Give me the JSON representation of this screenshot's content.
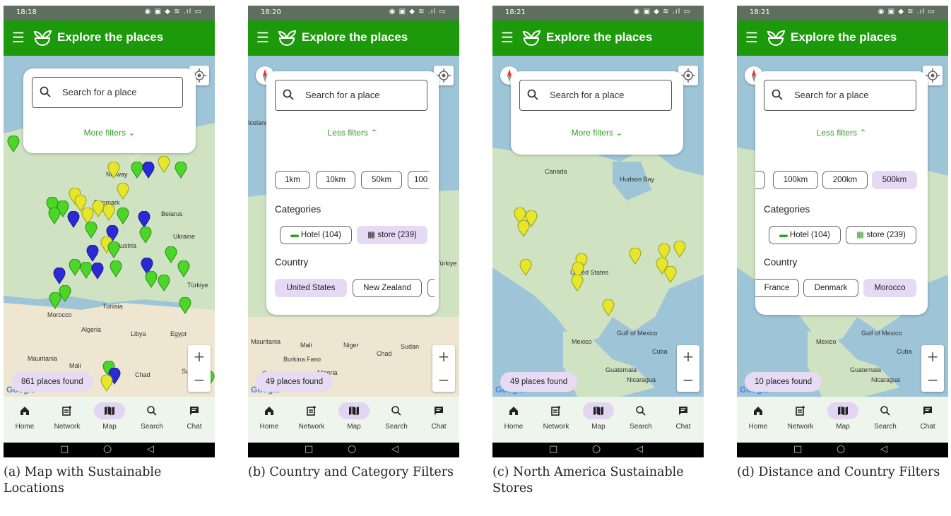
{
  "screens": [
    {
      "time": "18:18",
      "battery": "86",
      "title": "Explore the places",
      "search_placeholder": "Search for a place",
      "filter_toggle": "More filters",
      "count": "861 places found",
      "caption": "(a) Map with Sustainable Locations"
    },
    {
      "time": "18:20",
      "battery": "87",
      "title": "Explore the places",
      "search_placeholder": "Search for a place",
      "filter_toggle": "Less filters",
      "distances": [
        "1km",
        "10km",
        "50km",
        "100"
      ],
      "categories_heading": "Categories",
      "categories": [
        "Hotel (104)",
        "store (239)"
      ],
      "country_heading": "Country",
      "countries": [
        "United States",
        "New Zealand"
      ],
      "count": "49 places found",
      "caption": "(b) Country and Category Filters"
    },
    {
      "time": "18:21",
      "battery": "87",
      "title": "Explore the places",
      "search_placeholder": "Search for a place",
      "filter_toggle": "More filters",
      "count": "49 places found",
      "caption": "(c) North America Sustainable Stores"
    },
    {
      "time": "18:21",
      "battery": "87",
      "title": "Explore the places",
      "search_placeholder": "Search for a place",
      "filter_toggle": "Less filters",
      "distances": [
        "100km",
        "200km",
        "500km"
      ],
      "categories_heading": "Categories",
      "categories": [
        "Hotel (104)",
        "store (239)"
      ],
      "country_heading": "Country",
      "countries": [
        "France",
        "Denmark",
        "Morocco"
      ],
      "count": "10 places found",
      "caption": "(d) Distance and Country Filters"
    }
  ],
  "nav": [
    "Home",
    "Network",
    "Map",
    "Search",
    "Chat"
  ],
  "map_labels": {
    "a": [
      "Belarus",
      "Ukraine",
      "Austria",
      "Türkiye",
      "Tunisia",
      "Algeria",
      "Libya",
      "Egypt",
      "Mauritania",
      "Mali",
      "Chad",
      "Sudan",
      "Morocco",
      "Denmark",
      "Norway"
    ],
    "b": [
      "Iceland",
      "Mauritania",
      "Mali",
      "Niger",
      "Chad",
      "Sudan",
      "Burkina Faso",
      "Guinea",
      "Nigeria",
      "Türkiye"
    ],
    "c": [
      "Canada",
      "Hudson Bay",
      "United States",
      "Mexico",
      "Gulf of Mexico",
      "Cuba",
      "Guatemala",
      "Nicaragua"
    ],
    "d": [
      "Mexico",
      "Gulf of Mexico",
      "Cuba",
      "Guatemala",
      "Nicaragua"
    ]
  },
  "colors": {
    "appbar": "#1d9a0c",
    "pin_green": "#4cd627",
    "pin_yellow": "#e6e62a",
    "pin_blue": "#2a2ad6",
    "selected_chip": "#e5d9f3"
  }
}
